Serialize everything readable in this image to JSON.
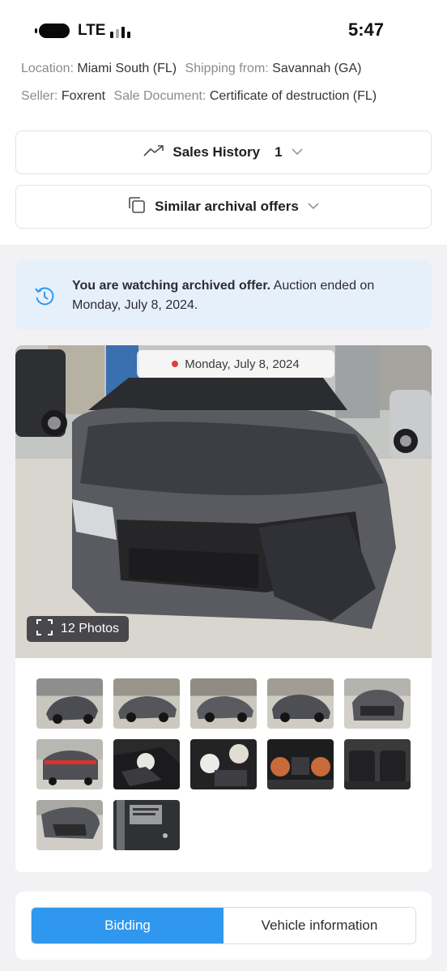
{
  "status_bar": {
    "network": "LTE",
    "time": "5:47"
  },
  "info": {
    "location_label": "Location:",
    "location_value": "Miami South (FL)",
    "shipping_label": "Shipping from:",
    "shipping_value": "Savannah (GA)",
    "seller_label": "Seller:",
    "seller_value": "Foxrent",
    "sale_doc_label": "Sale Document:",
    "sale_doc_value": "Certificate of destruction (FL)"
  },
  "sales_history": {
    "title": "Sales History",
    "count": "1",
    "icon": "trending-up-icon"
  },
  "similar_offers": {
    "title": "Similar archival offers",
    "icon": "copy-icon"
  },
  "notice": {
    "bold": "You are watching archived offer.",
    "rest": " Auction ended on Monday, July 8, 2024.",
    "icon": "history-icon"
  },
  "gallery": {
    "date": "Monday, July 8, 2024",
    "photos_label": "12 Photos",
    "thumbnails": [
      "front-left view",
      "left side view",
      "rear-left view",
      "front-right view",
      "front view",
      "rear view",
      "airbag interior",
      "deployed airbags",
      "instrument cluster",
      "rear seats",
      "hood damage",
      "door label"
    ]
  },
  "tabs": {
    "active": "Bidding",
    "inactive": "Vehicle information"
  },
  "colors": {
    "accent": "#2f97ee",
    "notice_bg": "#e6f0fb",
    "notice_icon": "#2f97ee",
    "live_dot": "#e23b3b"
  }
}
